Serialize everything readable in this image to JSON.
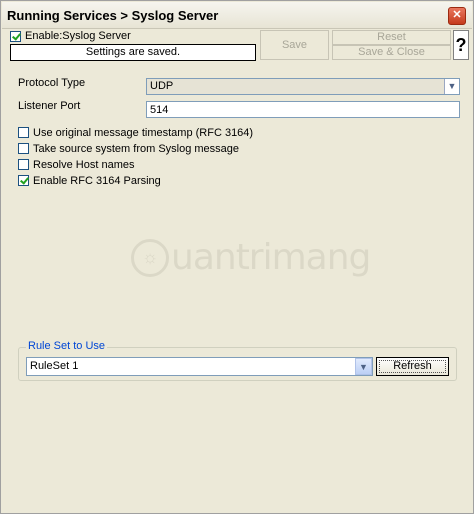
{
  "window": {
    "title": "Running Services > Syslog Server",
    "close_icon": "close-icon"
  },
  "header": {
    "enable_label": "Enable:Syslog Server",
    "enable_checked": true,
    "status_message": "Settings are saved.",
    "buttons": {
      "save": "Save",
      "reset": "Reset",
      "save_close": "Save & Close",
      "help": "?"
    }
  },
  "form": {
    "protocol_type_label": "Protocol Type",
    "protocol_type_value": "UDP",
    "listener_port_label": "Listener Port",
    "listener_port_value": "514",
    "options": [
      {
        "label": "Use original message timestamp (RFC 3164)",
        "checked": false
      },
      {
        "label": "Take source system from Syslog message",
        "checked": false
      },
      {
        "label": "Resolve Host names",
        "checked": false
      },
      {
        "label": "Enable RFC 3164 Parsing",
        "checked": true
      }
    ]
  },
  "watermark": {
    "text": "uantrimang"
  },
  "ruleset": {
    "group_title": "Rule Set to Use",
    "value": "RuleSet 1",
    "refresh_label": "Refresh"
  },
  "colors": {
    "background": "#ece9d8",
    "group_title": "#0046d5",
    "check_mark": "#21a121"
  }
}
